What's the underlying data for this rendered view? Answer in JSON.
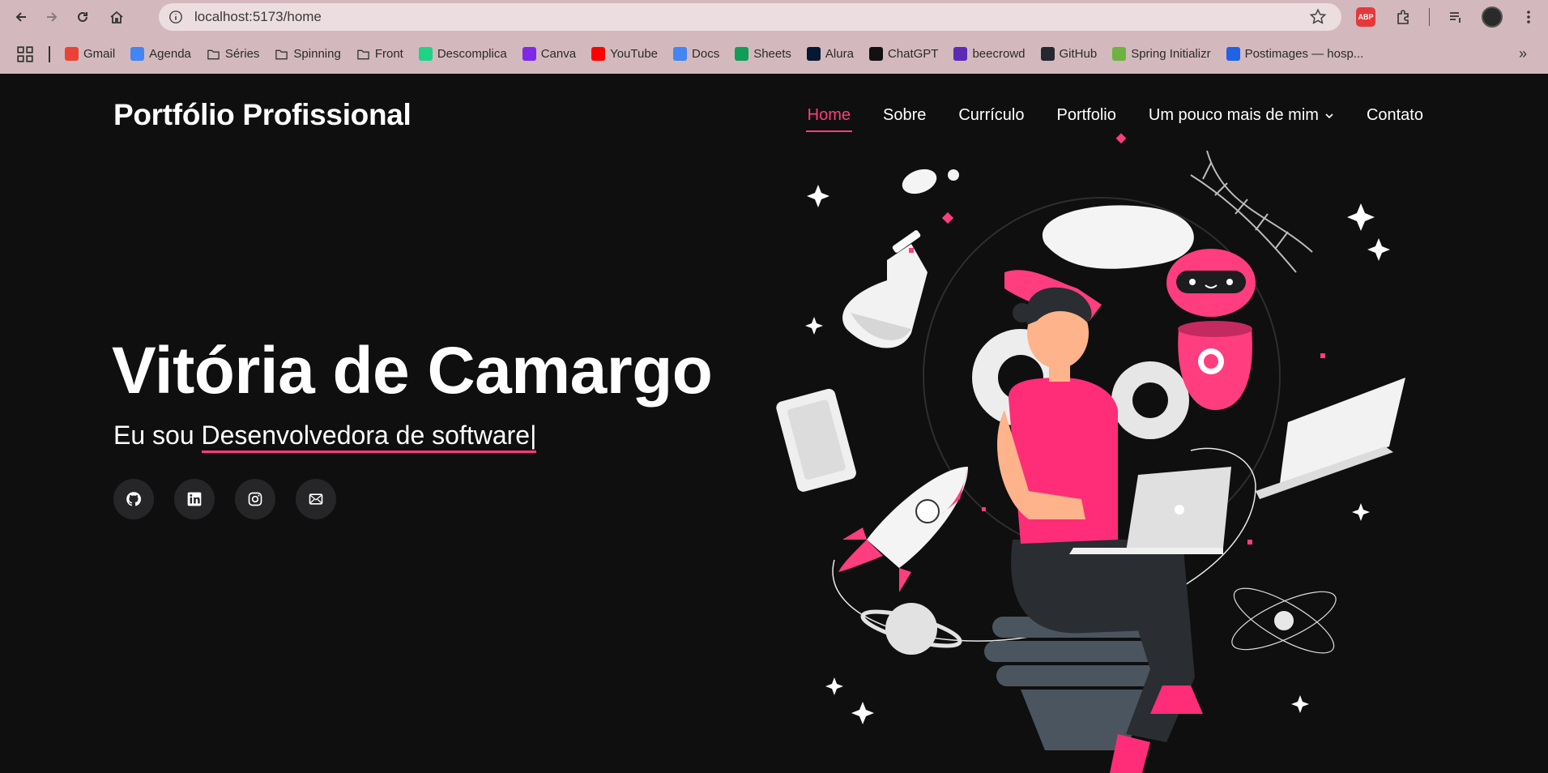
{
  "browser": {
    "url": "localhost:5173/home",
    "bookmarks": [
      {
        "label": "Gmail",
        "icon": "gmail-icon",
        "color": "#ea4335"
      },
      {
        "label": "Agenda",
        "icon": "calendar-icon",
        "color": "#4285f4"
      },
      {
        "label": "Séries",
        "icon": "folder-icon",
        "color": ""
      },
      {
        "label": "Spinning",
        "icon": "folder-icon",
        "color": ""
      },
      {
        "label": "Front",
        "icon": "folder-icon",
        "color": ""
      },
      {
        "label": "Descomplica",
        "icon": "descomplica-icon",
        "color": "#1fd286"
      },
      {
        "label": "Canva",
        "icon": "canva-icon",
        "color": "#7d2ae8"
      },
      {
        "label": "YouTube",
        "icon": "youtube-icon",
        "color": "#ff0000"
      },
      {
        "label": "Docs",
        "icon": "docs-icon",
        "color": "#4285f4"
      },
      {
        "label": "Sheets",
        "icon": "sheets-icon",
        "color": "#0f9d58"
      },
      {
        "label": "Alura",
        "icon": "alura-icon",
        "color": "#051933"
      },
      {
        "label": "ChatGPT",
        "icon": "chatgpt-icon",
        "color": "#111111"
      },
      {
        "label": "beecrowd",
        "icon": "beecrowd-icon",
        "color": "#5b2bb5"
      },
      {
        "label": "GitHub",
        "icon": "github-icon",
        "color": "#24292f"
      },
      {
        "label": "Spring Initializr",
        "icon": "spring-icon",
        "color": "#6db33f"
      },
      {
        "label": "Postimages — hosp...",
        "icon": "postimages-icon",
        "color": "#1e62e6"
      }
    ]
  },
  "site": {
    "brand": "Portfólio Profissional",
    "menu": [
      {
        "label": "Home",
        "active": true
      },
      {
        "label": "Sobre",
        "active": false
      },
      {
        "label": "Currículo",
        "active": false
      },
      {
        "label": "Portfolio",
        "active": false
      },
      {
        "label": "Um pouco mais de mim",
        "active": false
      },
      {
        "label": "Contato",
        "active": false
      }
    ],
    "hero": {
      "name": "Vitória de Camargo",
      "prefix": "Eu sou ",
      "typed": "Desenvolvedora de software|"
    },
    "socials": [
      "github-icon",
      "linkedin-icon",
      "instagram-icon",
      "mail-icon"
    ],
    "accent_color": "#ff3d7f",
    "background_color": "#0f0f10"
  }
}
